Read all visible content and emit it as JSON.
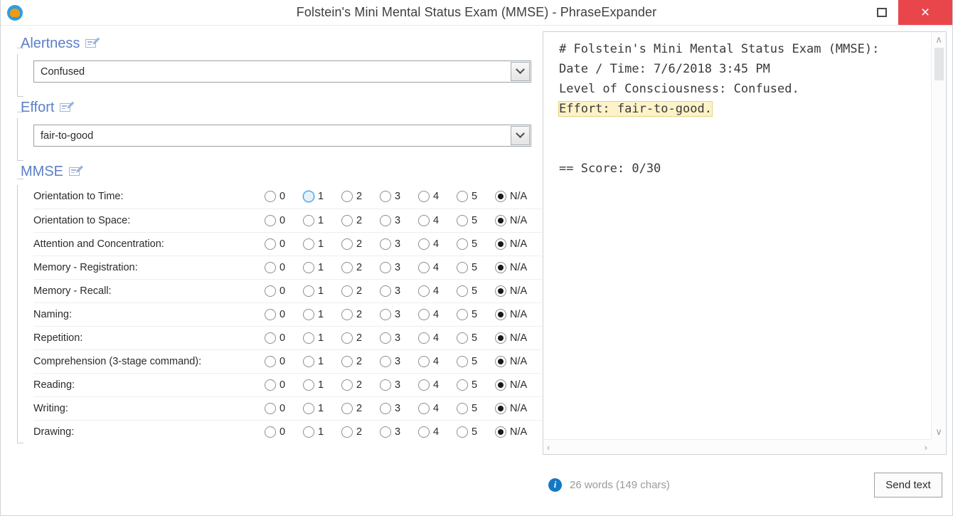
{
  "window": {
    "title": "Folstein's Mini Mental Status Exam (MMSE) - PhraseExpander",
    "maximize_label": "",
    "close_label": "×"
  },
  "groups": {
    "alertness": {
      "legend": "Alertness",
      "value": "Confused"
    },
    "effort": {
      "legend": "Effort",
      "value": "fair-to-good"
    },
    "mmse": {
      "legend": "MMSE"
    }
  },
  "mmse": {
    "options": [
      "0",
      "1",
      "2",
      "3",
      "4",
      "5",
      "N/A"
    ],
    "rows": [
      {
        "label": "Orientation to Time:",
        "selected": "N/A",
        "hovered": "1"
      },
      {
        "label": "Orientation to Space:",
        "selected": "N/A",
        "hovered": null
      },
      {
        "label": "Attention and Concentration:",
        "selected": "N/A",
        "hovered": null
      },
      {
        "label": "Memory - Registration:",
        "selected": "N/A",
        "hovered": null
      },
      {
        "label": "Memory - Recall:",
        "selected": "N/A",
        "hovered": null
      },
      {
        "label": "Naming:",
        "selected": "N/A",
        "hovered": null
      },
      {
        "label": "Repetition:",
        "selected": "N/A",
        "hovered": null
      },
      {
        "label": "Comprehension (3-stage command):",
        "selected": "N/A",
        "hovered": null
      },
      {
        "label": "Reading:",
        "selected": "N/A",
        "hovered": null
      },
      {
        "label": "Writing:",
        "selected": "N/A",
        "hovered": null
      },
      {
        "label": "Drawing:",
        "selected": "N/A",
        "hovered": null
      }
    ]
  },
  "preview": {
    "line1": "# Folstein's Mini Mental Status Exam (MMSE):",
    "line2": "Date / Time: 7/6/2018 3:45 PM",
    "line3": "Level of Consciousness: Confused.",
    "line4_highlighted": "Effort: fair-to-good.",
    "line5": "",
    "line6": "",
    "line7": "== Score: 0/30"
  },
  "status": {
    "word_count": "26 words (149 chars)",
    "send_label": "Send text"
  },
  "scrollbars": {
    "up": "∧",
    "down": "∨",
    "left": "‹",
    "right": "›"
  },
  "colors": {
    "legend": "#5b7fc7",
    "close": "#e8464b",
    "highlight": "#fdf3c8",
    "info": "#1578c4"
  }
}
